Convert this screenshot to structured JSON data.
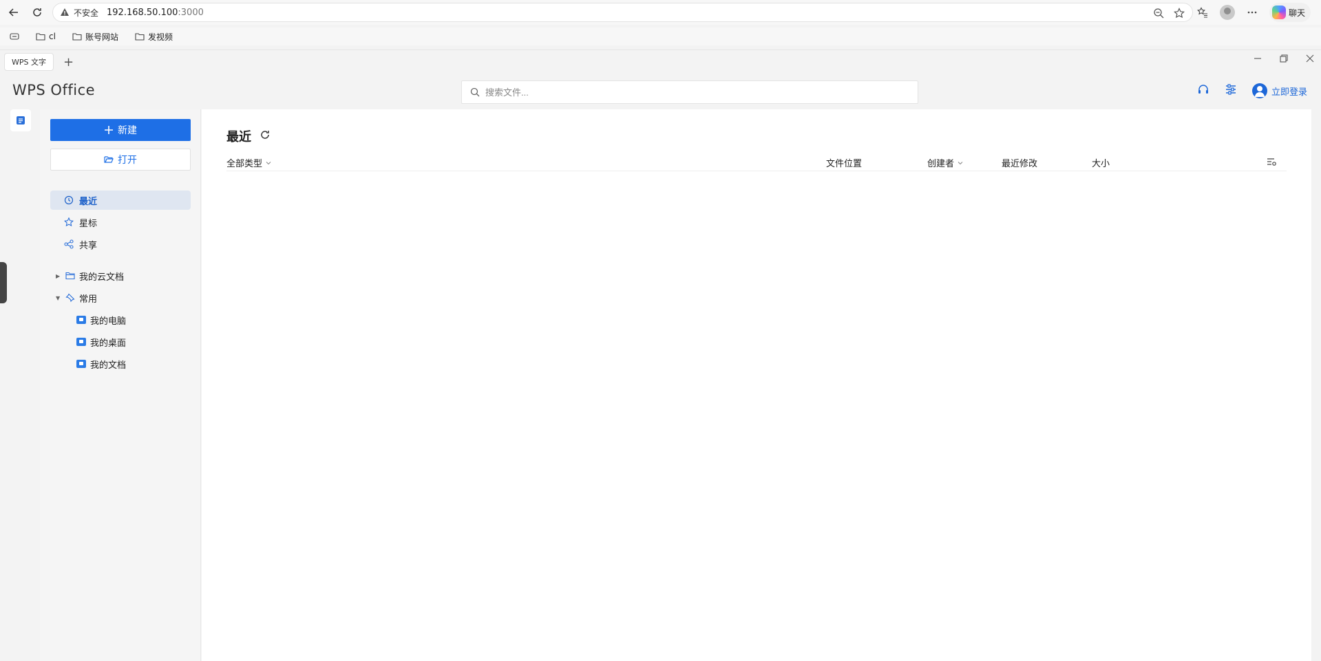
{
  "browser": {
    "security_label": "不安全",
    "url_host": "192.168.50.100",
    "url_port": ":3000",
    "chat_label": "聊天"
  },
  "bookmarks": [
    {
      "label": "cl"
    },
    {
      "label": "账号网站"
    },
    {
      "label": "发视频"
    }
  ],
  "window": {
    "tab_label": "WPS 文字"
  },
  "header": {
    "logo": "WPS Office",
    "search_placeholder": "搜索文件...",
    "login_label": "立即登录"
  },
  "sidebar": {
    "new_label": "新建",
    "open_label": "打开",
    "nav": [
      {
        "label": "最近",
        "active": true
      },
      {
        "label": "星标"
      },
      {
        "label": "共享"
      }
    ],
    "tree": [
      {
        "label": "我的云文档",
        "expanded": false
      },
      {
        "label": "常用",
        "expanded": true,
        "children": [
          {
            "label": "我的电脑"
          },
          {
            "label": "我的桌面"
          },
          {
            "label": "我的文档"
          }
        ]
      }
    ]
  },
  "main": {
    "title": "最近",
    "columns": {
      "type_filter": "全部类型",
      "location": "文件位置",
      "creator": "创建者",
      "modified": "最近修改",
      "size": "大小"
    }
  },
  "colors": {
    "accent": "#1e6fe6",
    "active_nav_bg": "#dfe6f1"
  }
}
